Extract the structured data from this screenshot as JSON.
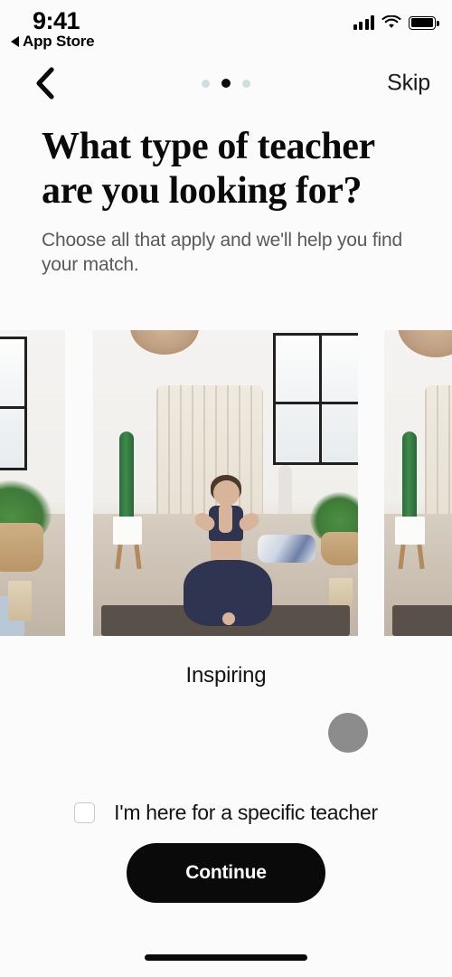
{
  "status_bar": {
    "time": "9:41",
    "return_app": "App Store",
    "return_icon": "triangle-left-icon",
    "signal_icon": "cellular-signal-icon",
    "wifi_icon": "wifi-icon",
    "battery_icon": "battery-full-icon"
  },
  "nav": {
    "back_icon": "chevron-left-icon",
    "skip_label": "Skip",
    "pager": {
      "total": 3,
      "active_index": 1
    }
  },
  "heading": {
    "title": "What type of teacher are you looking for?",
    "subtitle": "Choose all that apply and we'll help you find your match."
  },
  "carousel": {
    "cards": [
      {
        "label": "",
        "image_alt": "yoga-studio-meditation-photo"
      },
      {
        "label": "Inspiring",
        "image_alt": "woman-seated-meditation-yoga-studio-photo"
      },
      {
        "label": "",
        "image_alt": "yoga-studio-meditation-photo"
      }
    ],
    "active_label": "Inspiring",
    "select_button": "select-option-button"
  },
  "options": {
    "specific_teacher_label": "I'm here for a specific teacher",
    "specific_teacher_checked": false
  },
  "footer": {
    "continue_label": "Continue",
    "home_indicator": "home-indicator"
  },
  "colors": {
    "background": "#fbfbfb",
    "text_primary": "#0a0a0a",
    "text_secondary": "#5a5a5a",
    "accent_dark": "#0a0a0a",
    "dot_inactive": "#cfdede",
    "select_circle": "#8c8c8c"
  }
}
